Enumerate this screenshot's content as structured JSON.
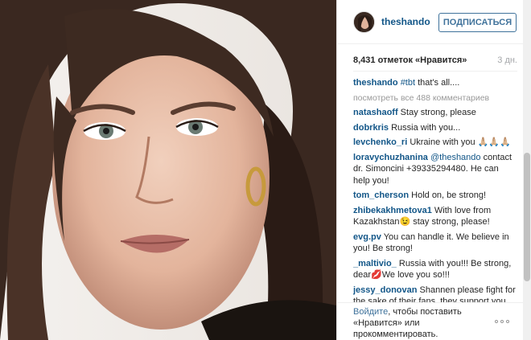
{
  "post": {
    "image_alt": "portrait"
  },
  "header": {
    "username": "theshando",
    "follow_label": "ПОДПИСАТЬСЯ"
  },
  "stats": {
    "likes": "8,431 отметок «Нравится»",
    "time": "3 дн."
  },
  "caption": {
    "author": "theshando",
    "hashtag": "#tbt",
    "text": " that's all...."
  },
  "view_all": "посмотреть все 488 комментариев",
  "comments": [
    {
      "author": "natashaoff",
      "text": " Stay strong, please"
    },
    {
      "author": "dobrkris",
      "text": " Russia with you..."
    },
    {
      "author": "levchenko_ri",
      "text": " Ukraine with you 🙏🏼🙏🏼🙏🏼"
    },
    {
      "author": "loravychuzhanina",
      "mention": "@theshando",
      "text": " contact dr. Simoncini +39335294480. He can help you!"
    },
    {
      "author": "tom_cherson",
      "text": " Hold on, be strong!"
    },
    {
      "author": "zhibekakhmetova1",
      "text": " With love from Kazakhstan😉 stay strong, please!"
    },
    {
      "author": "evg.pv",
      "text": " You can handle it. We believe in you! Be strong!"
    },
    {
      "author": "_maltivio_",
      "text": " Russia with you!!! Be strong, dear💋We love you so!!!"
    },
    {
      "author": "jessy_donovan",
      "text": " Shannen please fight for the sake of their fans, they support you and I, too !!! I was so sorry for you when"
    }
  ],
  "footer": {
    "login_link": "Войдите",
    "login_text": ", чтобы поставить «Нравится» или прокомментировать."
  },
  "icons": {
    "more": "more-options-icon"
  }
}
